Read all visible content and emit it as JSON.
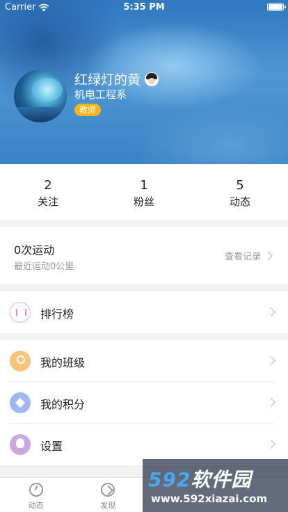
{
  "status_bar": {
    "carrier": "Carrier",
    "time": "5:35 PM"
  },
  "profile": {
    "name": "红绿灯的黄",
    "department": "机电工程系",
    "role_badge": "教师",
    "name_emoji_icon": "girl-face-icon"
  },
  "stats": [
    {
      "value": "2",
      "label": "关注"
    },
    {
      "value": "1",
      "label": "粉丝"
    },
    {
      "value": "5",
      "label": "动态"
    }
  ],
  "exercise": {
    "title": "0次运动",
    "subtitle": "最近运动0公里",
    "link": "查看记录"
  },
  "menu": {
    "ranking": "排行榜",
    "my_class": "我的班级",
    "my_points": "我的积分",
    "settings": "设置"
  },
  "tabbar": [
    {
      "label": "动态",
      "icon": "dashboard-icon"
    },
    {
      "label": "发现",
      "icon": "compass-icon"
    }
  ],
  "watermark": {
    "logo_num": "592",
    "logo_text": "软件园",
    "url": "www.592xiazai.com"
  },
  "colors": {
    "badge": "#f3b619",
    "header_blue": "#3a82c6",
    "page_bg": "#f2f2f2"
  }
}
